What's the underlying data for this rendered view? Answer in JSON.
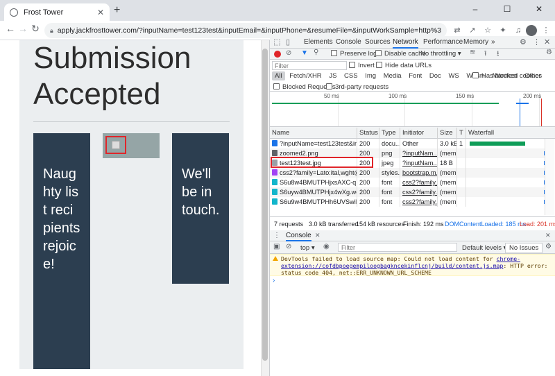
{
  "browser": {
    "tab_title": "Frost Tower",
    "tab_close": "✕",
    "new_tab": "+",
    "window_controls": [
      "–",
      "☐",
      "✕"
    ],
    "back": "←",
    "forward": "→",
    "reload": "↻",
    "url": "apply.jackfrosttower.com/?inputName=test123test&inputEmail=&inputPhone=&resumeFile=&inputWorkSample=http%3A%2F%2F169.254...",
    "toolbar_icons": [
      "translate-icon",
      "share-icon",
      "star-icon",
      "extensions-icon",
      "media-icon",
      "profile-icon",
      "menu-icon"
    ]
  },
  "page": {
    "heading": "Submission Accepted",
    "card1_text": "Naughty list recipients rejoice!",
    "card3_text": "We'll be in touch."
  },
  "devtools": {
    "tabs": [
      "Elements",
      "Console",
      "Sources",
      "Network",
      "Performance",
      "Memory",
      "»"
    ],
    "active_tab": "Network",
    "toolbar": {
      "preserve_log": "Preserve log",
      "disable_cache": "Disable cache",
      "throttling": "No throttling"
    },
    "filter": {
      "placeholder": "Filter",
      "invert": "Invert",
      "hide_data_urls": "Hide data URLs"
    },
    "type_filters": [
      "All",
      "Fetch/XHR",
      "JS",
      "CSS",
      "Img",
      "Media",
      "Font",
      "Doc",
      "WS",
      "Wasm",
      "Manifest",
      "Other"
    ],
    "has_blocked_cookies": "Has blocked cookies",
    "blocked_requests": "Blocked Requests",
    "third_party_requests": "3rd-party requests",
    "overview_ticks": [
      "50 ms",
      "100 ms",
      "150 ms",
      "200 ms"
    ],
    "columns": [
      "Name",
      "Status",
      "Type",
      "Initiator",
      "Size",
      "T",
      "Waterfall"
    ],
    "rows": [
      {
        "name": "?inputName=test123test&inp...",
        "status": "200",
        "type": "docu...",
        "initiator": "Other",
        "size": "3.0 kB",
        "t": "1",
        "icon_color": "#1a73e8"
      },
      {
        "name": "zoomed2.png",
        "status": "200",
        "type": "png",
        "initiator": "?inputNam...",
        "size": "(mem...",
        "t": "",
        "icon_color": "#5f6368"
      },
      {
        "name": "test123test.jpg",
        "status": "200",
        "type": "jpeg",
        "initiator": "?inputNam...",
        "size": "18 B",
        "t": "",
        "icon_color": "#9aa0a6"
      },
      {
        "name": "css2?family=Lato:ital,wght@0...",
        "status": "200",
        "type": "styles...",
        "initiator": "bootstrap.m...",
        "size": "(mem...",
        "t": "",
        "icon_color": "#a142f4"
      },
      {
        "name": "S6u8w4BMUTPHjxsAXC-q.woff2",
        "status": "200",
        "type": "font",
        "initiator": "css2?family...",
        "size": "(mem...",
        "t": "",
        "icon_color": "#12b5cb"
      },
      {
        "name": "S6uyw4BMUTPHjx4wXg.woff2",
        "status": "200",
        "type": "font",
        "initiator": "css2?family...",
        "size": "(mem...",
        "t": "",
        "icon_color": "#12b5cb"
      },
      {
        "name": "S6u9w4BMUTPHh6UVSwiPGQ...",
        "status": "200",
        "type": "font",
        "initiator": "css2?family...",
        "size": "(mem...",
        "t": "",
        "icon_color": "#12b5cb"
      }
    ],
    "status_bar": {
      "requests": "7 requests",
      "transferred": "3.0 kB transferred",
      "resources": "154 kB resources",
      "finish": "Finish: 192 ms",
      "dom_loaded": "DOMContentLoaded: 185 ms",
      "load": "Load: 201 ms"
    },
    "console": {
      "tab": "Console",
      "context": "top ▾",
      "filter_placeholder": "Filter",
      "levels": "Default levels ▾",
      "issues": "No Issues",
      "warning_prefix": "DevTools failed to load source map: Could not load content for ",
      "warning_link": "chrome-extension://cofdbpoegempiloogbagkncekinflcnj/build/content.js.map",
      "warning_suffix": ": HTTP error: status code 404, net::ERR_UNKNOWN_URL_SCHEME",
      "prompt": "›"
    },
    "colors": {
      "accent": "#1a73e8",
      "highlight": "#e0252a",
      "waterfall_green": "#0f9d58",
      "dom_loaded": "#1a73e8",
      "load": "#d93025"
    }
  }
}
